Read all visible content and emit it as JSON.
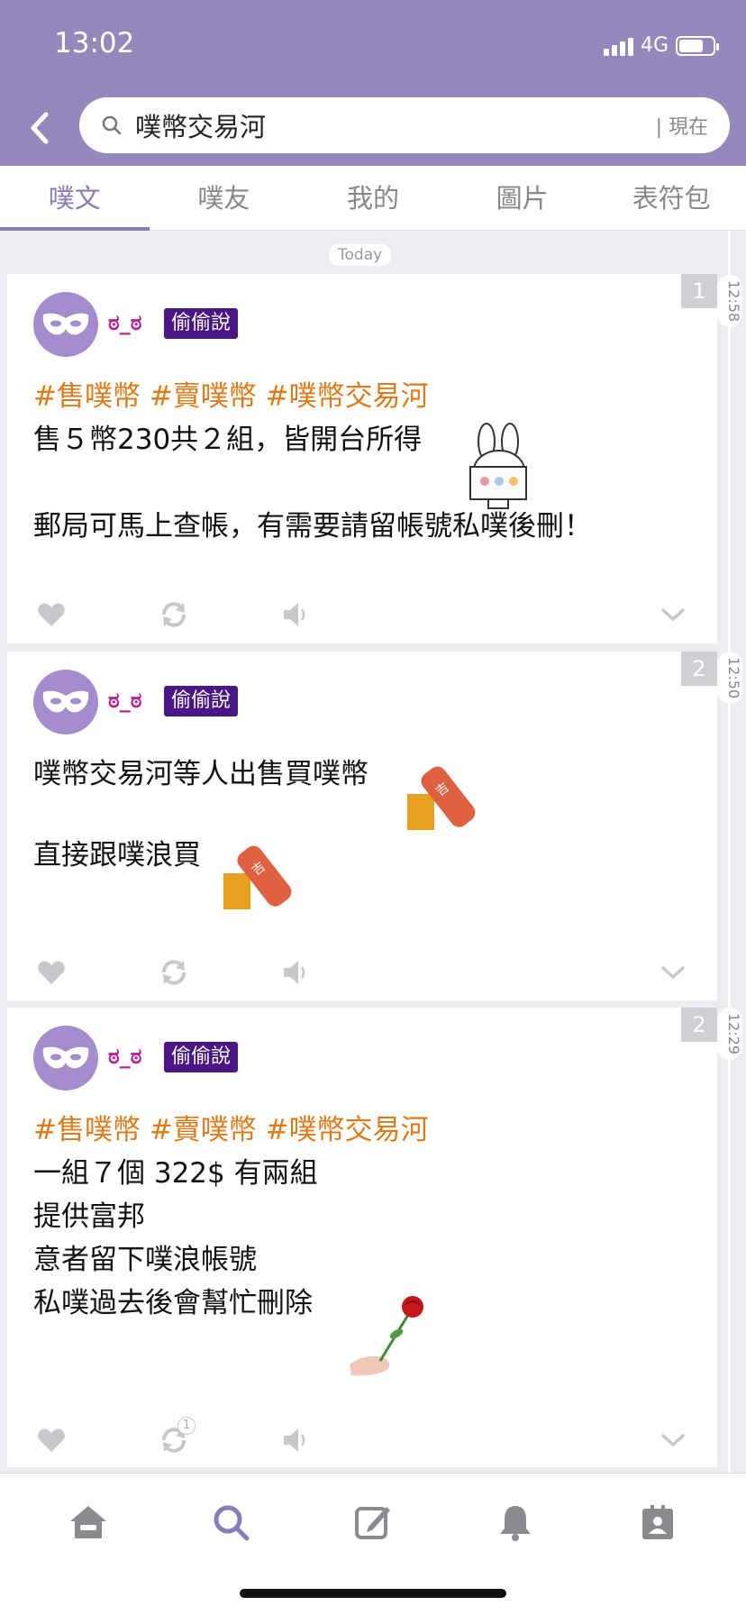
{
  "status": {
    "time": "13:02",
    "network": "4G"
  },
  "search": {
    "query": "噗幣交易河",
    "now_label": "| 現在"
  },
  "tabs": [
    {
      "label": "噗文",
      "active": true
    },
    {
      "label": "噗友"
    },
    {
      "label": "我的"
    },
    {
      "label": "圖片"
    },
    {
      "label": "表符包"
    }
  ],
  "today_label": "Today",
  "posts": [
    {
      "count": "1",
      "time": "12:58",
      "user": "ಠ_ಠ",
      "tag": "偷偷說",
      "hashtags": "#售噗幣 #賣噗幣 #噗幣交易河",
      "lines": [
        "售５幣230共２組，皆開台所得",
        "",
        "郵局可馬上查帳，有需要請留帳號私噗後刪！"
      ]
    },
    {
      "count": "2",
      "time": "12:50",
      "user": "ಠ_ಠ",
      "tag": "偷偷說",
      "lines": [
        "噗幣交易河等人出售買噗幣",
        "",
        "直接跟噗浪買"
      ]
    },
    {
      "count": "2",
      "time": "12:29",
      "user": "ಠ_ಠ",
      "tag": "偷偷說",
      "hashtags": "#售噗幣 #賣噗幣 #噗幣交易河",
      "lines": [
        "一組７個 322$ 有兩組",
        "提供富邦",
        "意者留下噗浪帳號",
        "私噗過去後會幫忙刪除"
      ],
      "replurk_count": "1"
    }
  ],
  "colors": {
    "header": "#9589bc",
    "accent": "#8a7ab6",
    "hashtag": "#de7a17",
    "username": "#b6239a",
    "tag_bg": "#4a1585"
  },
  "icons": [
    "back-icon",
    "search-icon",
    "heart-icon",
    "replurk-icon",
    "mute-icon",
    "chevron-down-icon",
    "home-icon",
    "compose-icon",
    "bell-icon",
    "profile-icon"
  ]
}
